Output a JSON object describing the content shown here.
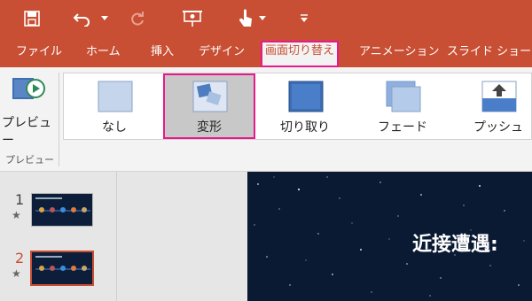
{
  "quick_access": {
    "icons": [
      "save-icon",
      "undo-icon",
      "dropdown-icon",
      "redo-icon",
      "present-from-start-icon",
      "touch-mode-icon",
      "customize-toolbar-icon"
    ]
  },
  "tabs": [
    {
      "label": "ファイル"
    },
    {
      "label": "ホーム"
    },
    {
      "label": "挿入"
    },
    {
      "label": "デザイン"
    },
    {
      "label": "画面切り替え",
      "active": true
    },
    {
      "label": "アニメーション"
    },
    {
      "label": "スライド ショー"
    }
  ],
  "ribbon": {
    "preview_label": "プレビュー",
    "preview_group_label": "プレビュー",
    "transitions": [
      {
        "label": "なし"
      },
      {
        "label": "変形",
        "selected": true
      },
      {
        "label": "切り取り"
      },
      {
        "label": "フェード"
      },
      {
        "label": "プッシュ"
      }
    ]
  },
  "slide_pane": {
    "slides": [
      {
        "number": "1",
        "star": "★"
      },
      {
        "number": "2",
        "star": "★",
        "current": true
      }
    ]
  },
  "main_slide": {
    "title": "近接遭遇:"
  },
  "colors": {
    "accent": "#c84f33",
    "highlight": "#e8198b",
    "slide_bg": "#0a1a33"
  }
}
